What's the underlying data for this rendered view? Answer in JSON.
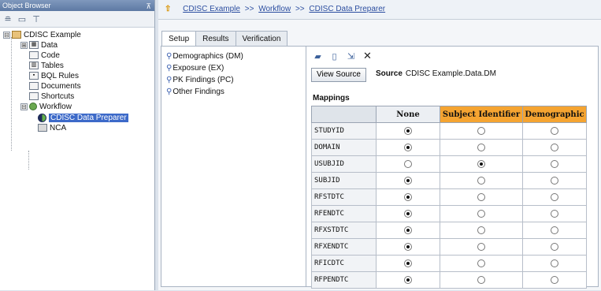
{
  "left_panel": {
    "title": "Object Browser",
    "tree": [
      {
        "label": "CDISC Example",
        "toggle": "⊟",
        "icon": "project-icon"
      },
      {
        "label": "Data",
        "toggle": "⊞",
        "icon": "data-icon"
      },
      {
        "label": "Code",
        "icon": "code-icon"
      },
      {
        "label": "Tables",
        "icon": "tables-icon"
      },
      {
        "label": "BQL Rules",
        "icon": "bql-icon"
      },
      {
        "label": "Documents",
        "icon": "documents-icon"
      },
      {
        "label": "Shortcuts",
        "icon": "shortcuts-icon"
      },
      {
        "label": "Workflow",
        "toggle": "⊟",
        "icon": "workflow-icon"
      },
      {
        "label": "CDISC Data Preparer",
        "icon": "data-preparer-icon",
        "selected": true
      },
      {
        "label": "NCA",
        "icon": "nca-icon"
      }
    ]
  },
  "breadcrumb": [
    "CDISC Example",
    "Workflow",
    "CDISC Data Preparer"
  ],
  "breadcrumb_sep": ">>",
  "tabs": [
    "Setup",
    "Results",
    "Verification"
  ],
  "active_tab": "Setup",
  "domains": [
    "Demographics (DM)",
    "Exposure (EX)",
    "PK Findings (PC)",
    "Other Findings"
  ],
  "detail": {
    "view_source_label": "View Source",
    "source_label": "Source",
    "source_value": "CDISC Example.Data.DM",
    "mappings_label": "Mappings"
  },
  "mapping_table": {
    "columns": [
      "None",
      "Subject Identifier",
      "Demographic"
    ],
    "rows": [
      {
        "var": "STUDYID",
        "selected": 0
      },
      {
        "var": "DOMAIN",
        "selected": 0
      },
      {
        "var": "USUBJID",
        "selected": 1
      },
      {
        "var": "SUBJID",
        "selected": 0
      },
      {
        "var": "RFSTDTC",
        "selected": 0
      },
      {
        "var": "RFENDTC",
        "selected": 0
      },
      {
        "var": "RFXSTDTC",
        "selected": 0
      },
      {
        "var": "RFXENDTC",
        "selected": 0
      },
      {
        "var": "RFICDTC",
        "selected": 0
      },
      {
        "var": "RFPENDTC",
        "selected": 0
      }
    ]
  },
  "colors": {
    "accent_header": "#f5a431",
    "selection": "#3d6ac9",
    "link": "#2c4ea0"
  }
}
